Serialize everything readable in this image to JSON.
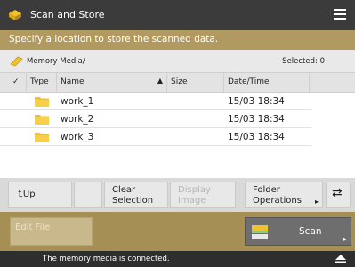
{
  "title": {
    "text": "Scan and Store",
    "icon": "scan-store-icon",
    "menu_icon": "hamburger-menu-icon"
  },
  "instruction": "Specify a location to store the scanned data.",
  "location": {
    "icon": "memory-media-icon",
    "label": "Memory Media/",
    "selected_text": "Selected: 0"
  },
  "columns": {
    "type": "Type",
    "name": "Name",
    "size": "Size",
    "date": "Date/Time",
    "sort_indicator": "▲",
    "check_mark": "✓"
  },
  "files": [
    {
      "name": "work_1",
      "date": "15/03  18:34",
      "icon": "folder-icon"
    },
    {
      "name": "work_2",
      "date": "15/03  18:34",
      "icon": "folder-icon"
    },
    {
      "name": "work_3",
      "date": "15/03  18:34",
      "icon": "folder-icon"
    }
  ],
  "toolbar": {
    "up": "Up",
    "clear_line1": "Clear",
    "clear_line2": "Selection",
    "display_line1": "Display",
    "display_line2": "Image",
    "folder_line1": "Folder",
    "folder_line2": "Operations",
    "refresh_icon": "⇄"
  },
  "edit_file": "Edit File",
  "scan": "Scan",
  "status": "The memory media is connected.",
  "colors": {
    "accent": "#b09a5f",
    "panel": "#a58f55",
    "dark": "#3b3b3b",
    "folder": "#f2c12e"
  }
}
